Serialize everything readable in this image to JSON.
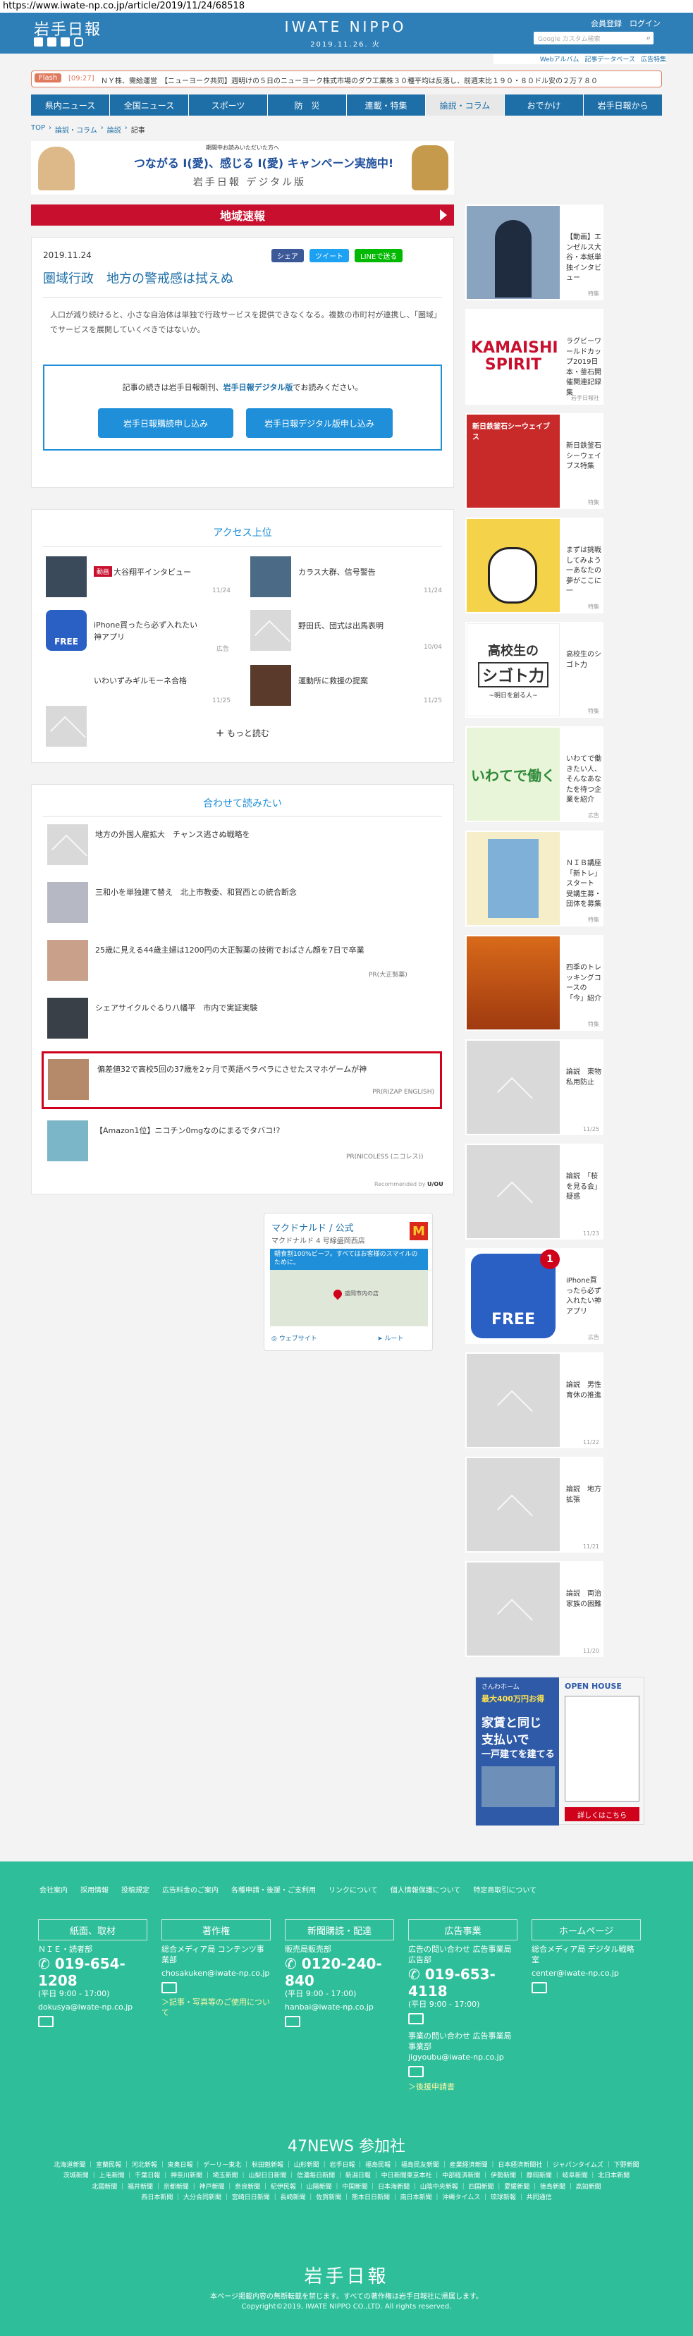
{
  "browser": {
    "url": "https://www.iwate-np.co.jp/article/2019/11/24/68518"
  },
  "header": {
    "logo_left": "岩手日報",
    "logo_center": "IWATE NIPPO",
    "date": "2019.11.26. 火",
    "links": [
      "会員登録",
      "ログイン"
    ],
    "search_placeholder": "Google カスタム検索",
    "sub_links": [
      "Webアルバム",
      "記事データベース",
      "広告特集"
    ]
  },
  "flash": {
    "label": "Flash",
    "time": "[09:27]",
    "text": "ＮＹ株、需給運営　【ニューヨーク共同】週明けの５日のニューヨーク株式市場のダウ工業株３０種平均は反落し、前週末比１９０・８０ドル安の２万７８０"
  },
  "nav": [
    "県内ニュース",
    "全国ニュース",
    "スポーツ",
    "防　災",
    "連載・特集",
    "論説・コラム",
    "おでかけ",
    "岩手日報から"
  ],
  "nav_active": 5,
  "breadcrumb": [
    "TOP",
    "論説・コラム",
    "論説",
    "記事"
  ],
  "banner": {
    "small": "期間中お読みいただいた方へ",
    "headline": "つながる I(愛)、感じる I(愛) キャンペーン実施中!",
    "brand": "岩手日報 デジタル版"
  },
  "section_bar": "地域速報",
  "article": {
    "date": "2019.11.24",
    "title": "圏域行政　地方の警戒感は拭えぬ",
    "share": [
      "シェア",
      "ツイート",
      "LINEで送る"
    ],
    "lead": "人口が減り続けると、小さな自治体は単独で行政サービスを提供できなくなる。複数の市町村が連携し、「圏域」でサービスを展開していくべきではないか。",
    "paywall_text_a": "記事の続きは岩手日報朝刊、",
    "paywall_text_b": "岩手日報デジタル版",
    "paywall_text_c": "でお読みください。",
    "btn_subscribe": "岩手日報購読申し込み",
    "btn_digital": "岩手日報デジタル版申し込み"
  },
  "ranking": {
    "title": "アクセス上位",
    "items": [
      {
        "badge": "動画",
        "title": "大谷翔平インタビュー",
        "date": "11/24"
      },
      {
        "badge": "",
        "title": "カラス大群、信号警告",
        "date": "11/24"
      },
      {
        "badge": "",
        "title": "iPhone買ったら必ず入れたい神アプリ",
        "date": "広告"
      },
      {
        "badge": "",
        "title": "野田氏、団式は出馬表明",
        "date": "10/04"
      },
      {
        "badge": "",
        "title": "いわいずみギルモーネ合格",
        "date": "11/25"
      },
      {
        "badge": "",
        "title": "運動所に救援の提案",
        "date": "11/25"
      }
    ],
    "more": "もっと読む"
  },
  "related": {
    "title": "合わせて読みたい",
    "items": [
      {
        "title": "地方の外国人雇拡大　チャンス逃さぬ戦略を",
        "source": ""
      },
      {
        "title": "三和小を単独建て替え　北上市教委、和賀西との統合断念",
        "source": ""
      },
      {
        "title": "25歳に見える44歳主婦は1200円の大正製薬の技術でおばさん顔を7日で卒業",
        "source": "PR(大正製薬)"
      },
      {
        "title": "シェアサイクルぐるり八幡平　市内で実証実験",
        "source": ""
      },
      {
        "title": "偏差値32で高校5回の37歳を2ヶ月で英語ペラペラにさせたスマホゲームが神",
        "source": "PR(RIZAP ENGLISH)"
      },
      {
        "title": "【Amazon1位】ニコチン0mgなのにまるでタバコ!?",
        "source": "PR(NICOLESS (ニコレス))"
      }
    ],
    "recommended_by": "Recommended by",
    "recommended_brand": "U/OU"
  },
  "map_ad": {
    "title": "マクドナルド / 公式",
    "sub": "マクドナルド 4 号線盛岡西店",
    "notice": "朝食割100%ビーフ。すべてはお客様のスマイルのために。",
    "pin": "盛岡市内の店",
    "btn_web": "ウェブサイト",
    "btn_route": "ルート"
  },
  "sidebar": [
    {
      "title": "【動画】エンゼルス大谷・本紙単独インタビュー",
      "date": "特集"
    },
    {
      "title": "ラグビーワールドカップ2019日本・釜石開催関連記録集",
      "date": "岩手日報社"
    },
    {
      "title": "新日鉄釜石シーウェイブス特集",
      "date": "特集"
    },
    {
      "title": "まずは挑戦してみよう一あなたの夢がここに一",
      "date": "特集"
    },
    {
      "title": "高校生のシゴト力",
      "date": "特集"
    },
    {
      "title": "いわてで働きたい人、そんなあなたを待つ企業を紹介",
      "date": "広告"
    },
    {
      "title": "ＮＩＢ講座「新トレ」スタート　受講生募・団体を募集",
      "date": "特集"
    },
    {
      "title": "四季のトレッキングコースの「今」紹介",
      "date": "特集"
    },
    {
      "title": "論説　東物私用防止",
      "date": "11/25"
    },
    {
      "title": "論説　「桜を見る会」疑惑",
      "date": "11/23"
    },
    {
      "title": "iPhone買ったら必ず入れたい神アプリ",
      "date": "広告"
    },
    {
      "title": "論説　男性育休の推進",
      "date": "11/22"
    },
    {
      "title": "論説　地方拡張",
      "date": "11/21"
    },
    {
      "title": "論説　両治家族の困難",
      "date": "11/20"
    }
  ],
  "side_images": {
    "kamaishi": "KAMAISHI SPIRIT",
    "seawaves": "新日鉄釜石シーウェイブス",
    "kokosei": "高校生の",
    "shigoto": "シゴト力",
    "kokosei_sub": "~明日を創る人~",
    "iwatede": "いわてで働く",
    "free": "FREE"
  },
  "side_ad": {
    "label": "さんわホーム",
    "price": "最大400万円お得",
    "headline1": "家賃と同じ",
    "headline2": "支払いで",
    "headline3": "一戸建てを建てる",
    "openhouse": "OPEN HOUSE",
    "button": "詳しくはこちら"
  },
  "footer": {
    "links": [
      "会社案内",
      "採用情報",
      "投稿規定",
      "広告料金のご案内",
      "各種申請・後援・ご支利用",
      "リンクについて",
      "個人情報保護について",
      "特定商取引について"
    ],
    "boxes": [
      "紙面、取材",
      "著作権",
      "新聞購読・配達",
      "広告事業",
      "ホームページ"
    ],
    "cols": [
      {
        "title": "ＮＩＥ・読者部",
        "phone": "019-654-1208",
        "hours": "(平日 9:00 - 17:00)",
        "mail": "dokusya@iwate-np.co.jp"
      },
      {
        "title": "総合メディア局 コンテンツ事業部",
        "phone": "",
        "hours": "",
        "mail": "chosakuken@iwate-np.co.jp",
        "note": "＞記事・写真等のご使用について"
      },
      {
        "title": "販売局販売部",
        "phone": "0120-240-840",
        "hours": "(平日 9:00 - 17:00)",
        "mail": "hanbai@iwate-np.co.jp"
      },
      {
        "title": "広告の問い合わせ 広告事業局広告部",
        "phone": "019-653-4118",
        "hours": "(平日 9:00 - 17:00)",
        "mail": "",
        "extra_title": "事業の問い合わせ 広告事業局事業部",
        "extra_mail": "jigyoubu@iwate-np.co.jp",
        "note": "＞後援申請書"
      },
      {
        "title": "総合メディア局 デジタル戦略室",
        "phone": "",
        "hours": "",
        "mail": "center@iwate-np.co.jp"
      }
    ],
    "n47": "47NEWS 参加社",
    "papers1": "北海道新聞 ｜ 室蘭民報 ｜ 河北新報 ｜ 東奥日報 ｜ デーリー東北 ｜ 秋田魁新報 ｜ 山形新聞 ｜ 岩手日報 ｜ 福島民報 ｜ 福島民友新聞 ｜ 産業経済新聞 ｜ 日本経済新聞社 ｜ ジャパンタイムズ ｜ 下野新聞",
    "papers2": "茨城新聞 ｜ 上毛新聞 ｜ 千葉日報 ｜ 神奈川新聞 ｜ 埼玉新聞 ｜ 山梨日日新聞 ｜ 信濃毎日新聞 ｜ 新潟日報 ｜ 中日新聞東京本社 ｜ 中部経済新聞 ｜ 伊勢新聞 ｜ 静岡新聞 ｜ 岐阜新聞 ｜ 北日本新聞",
    "papers3": "北國新聞 ｜ 福井新聞 ｜ 京都新聞 ｜ 神戸新聞 ｜ 奈良新聞 ｜ 紀伊民報 ｜ 山陽新聞 ｜ 中国新聞 ｜ 日本海新聞 ｜ 山陰中央新報 ｜ 四国新聞 ｜ 愛媛新聞 ｜ 徳島新聞 ｜ 高知新聞",
    "papers4": "西日本新聞 ｜ 大分合同新聞 ｜ 宮崎日日新聞 ｜ 長崎新聞 ｜ 佐賀新聞 ｜ 熊本日日新聞 ｜ 南日本新聞 ｜ 沖縄タイムス ｜ 琉球新報 ｜ 共同通信",
    "logo": "岩手日報",
    "notice": "本ページ掲載内容の無断転載を禁じます。すべての著作権は岩手日報社に帰属します。",
    "copyright": "Copyright©2019, IWATE NIPPO CO.,LTD. All rights reserved."
  }
}
